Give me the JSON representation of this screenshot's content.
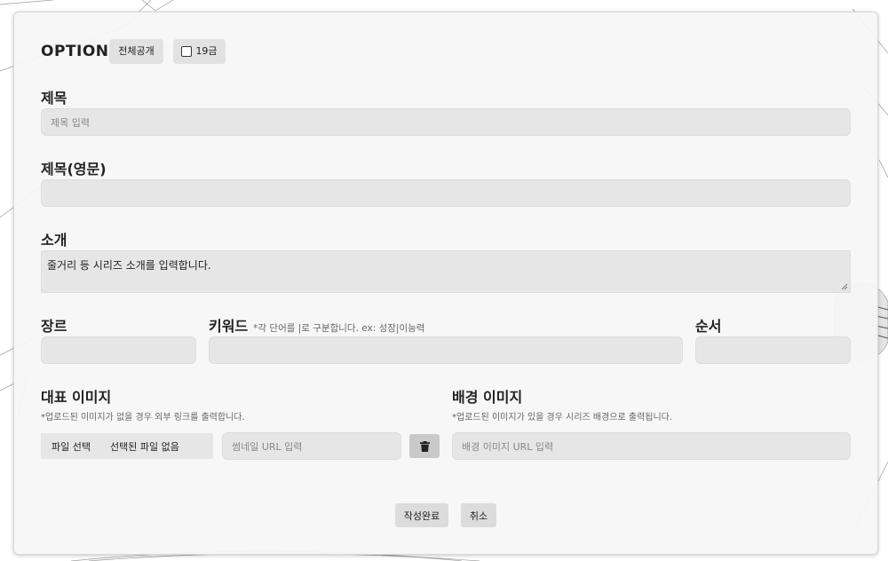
{
  "header": {
    "option_title": "OPTION",
    "public_label": "전체공개",
    "adult_label": "19금"
  },
  "title_field": {
    "label": "제목",
    "placeholder": "제목 입력",
    "value": ""
  },
  "title_en_field": {
    "label": "제목(영문)",
    "value": ""
  },
  "intro_field": {
    "label": "소개",
    "value": "줄거리 등 시리즈 소개를 입력합니다."
  },
  "genre_field": {
    "label": "장르",
    "value": ""
  },
  "keyword_field": {
    "label": "키워드",
    "hint": "*각 단어를 |로 구분합니다. ex: 성장|이능력",
    "value": ""
  },
  "order_field": {
    "label": "순서",
    "value": ""
  },
  "main_image": {
    "label": "대표 이미지",
    "hint": "*업로드된 이미지가 없을 경우 외부 링크를 출력합니다.",
    "file_button": "파일 선택",
    "file_status": "선택된 파일 없음",
    "url_placeholder": "썸네일 URL 입력"
  },
  "bg_image": {
    "label": "배경 이미지",
    "hint": "*업로드된 이미지가 있을 경우 시리즈 배경으로 출력됩니다.",
    "url_placeholder": "배경 이미지 URL 입력"
  },
  "actions": {
    "submit": "작성완료",
    "cancel": "취소"
  },
  "icons": {
    "delete": "trash-icon"
  }
}
